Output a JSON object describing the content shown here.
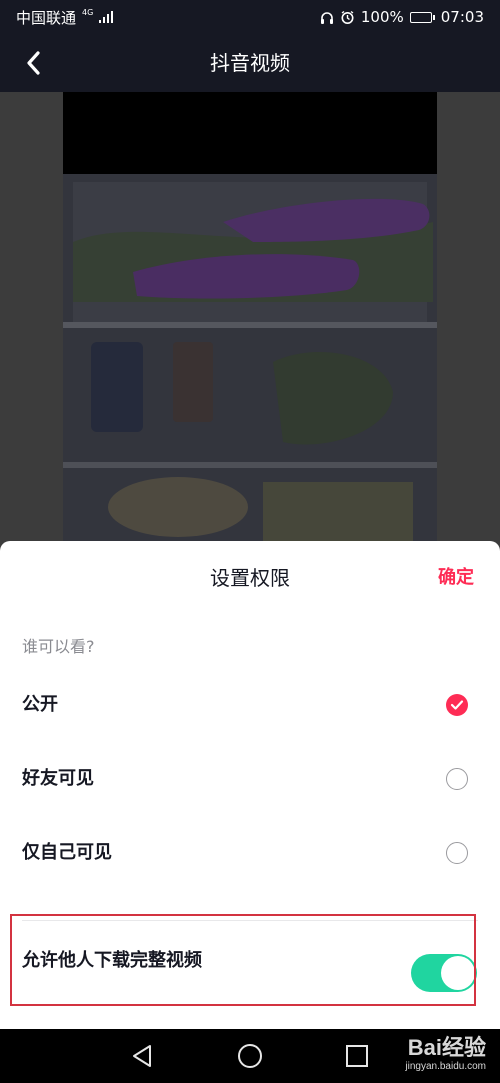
{
  "status_bar": {
    "carrier": "中国联通",
    "network_type": "4G",
    "battery_percent": "100%",
    "battery_level": 1.0,
    "time": "07:03",
    "icons": [
      "signal-icon",
      "headphone-icon",
      "alarm-icon",
      "battery-icon"
    ]
  },
  "header": {
    "title": "抖音视频",
    "back_icon": "chevron-left-icon"
  },
  "sheet": {
    "title": "设置权限",
    "confirm_label": "确定",
    "section_label": "谁可以看?",
    "options": [
      {
        "label": "公开",
        "selected": true
      },
      {
        "label": "好友可见",
        "selected": false
      },
      {
        "label": "仅自己可见",
        "selected": false
      }
    ],
    "download": {
      "label": "允许他人下载完整视频",
      "enabled": true
    }
  },
  "nav_bar": {
    "icons": [
      "back-triangle-icon",
      "home-circle-icon",
      "recents-square-icon"
    ]
  },
  "watermark": {
    "main": "Bai经验",
    "url": "jingyan.baidu.com"
  },
  "colors": {
    "accent": "#fe2c55",
    "toggle_on": "#20d5a0",
    "highlight": "#d33340",
    "dark_bar": "#161823"
  }
}
